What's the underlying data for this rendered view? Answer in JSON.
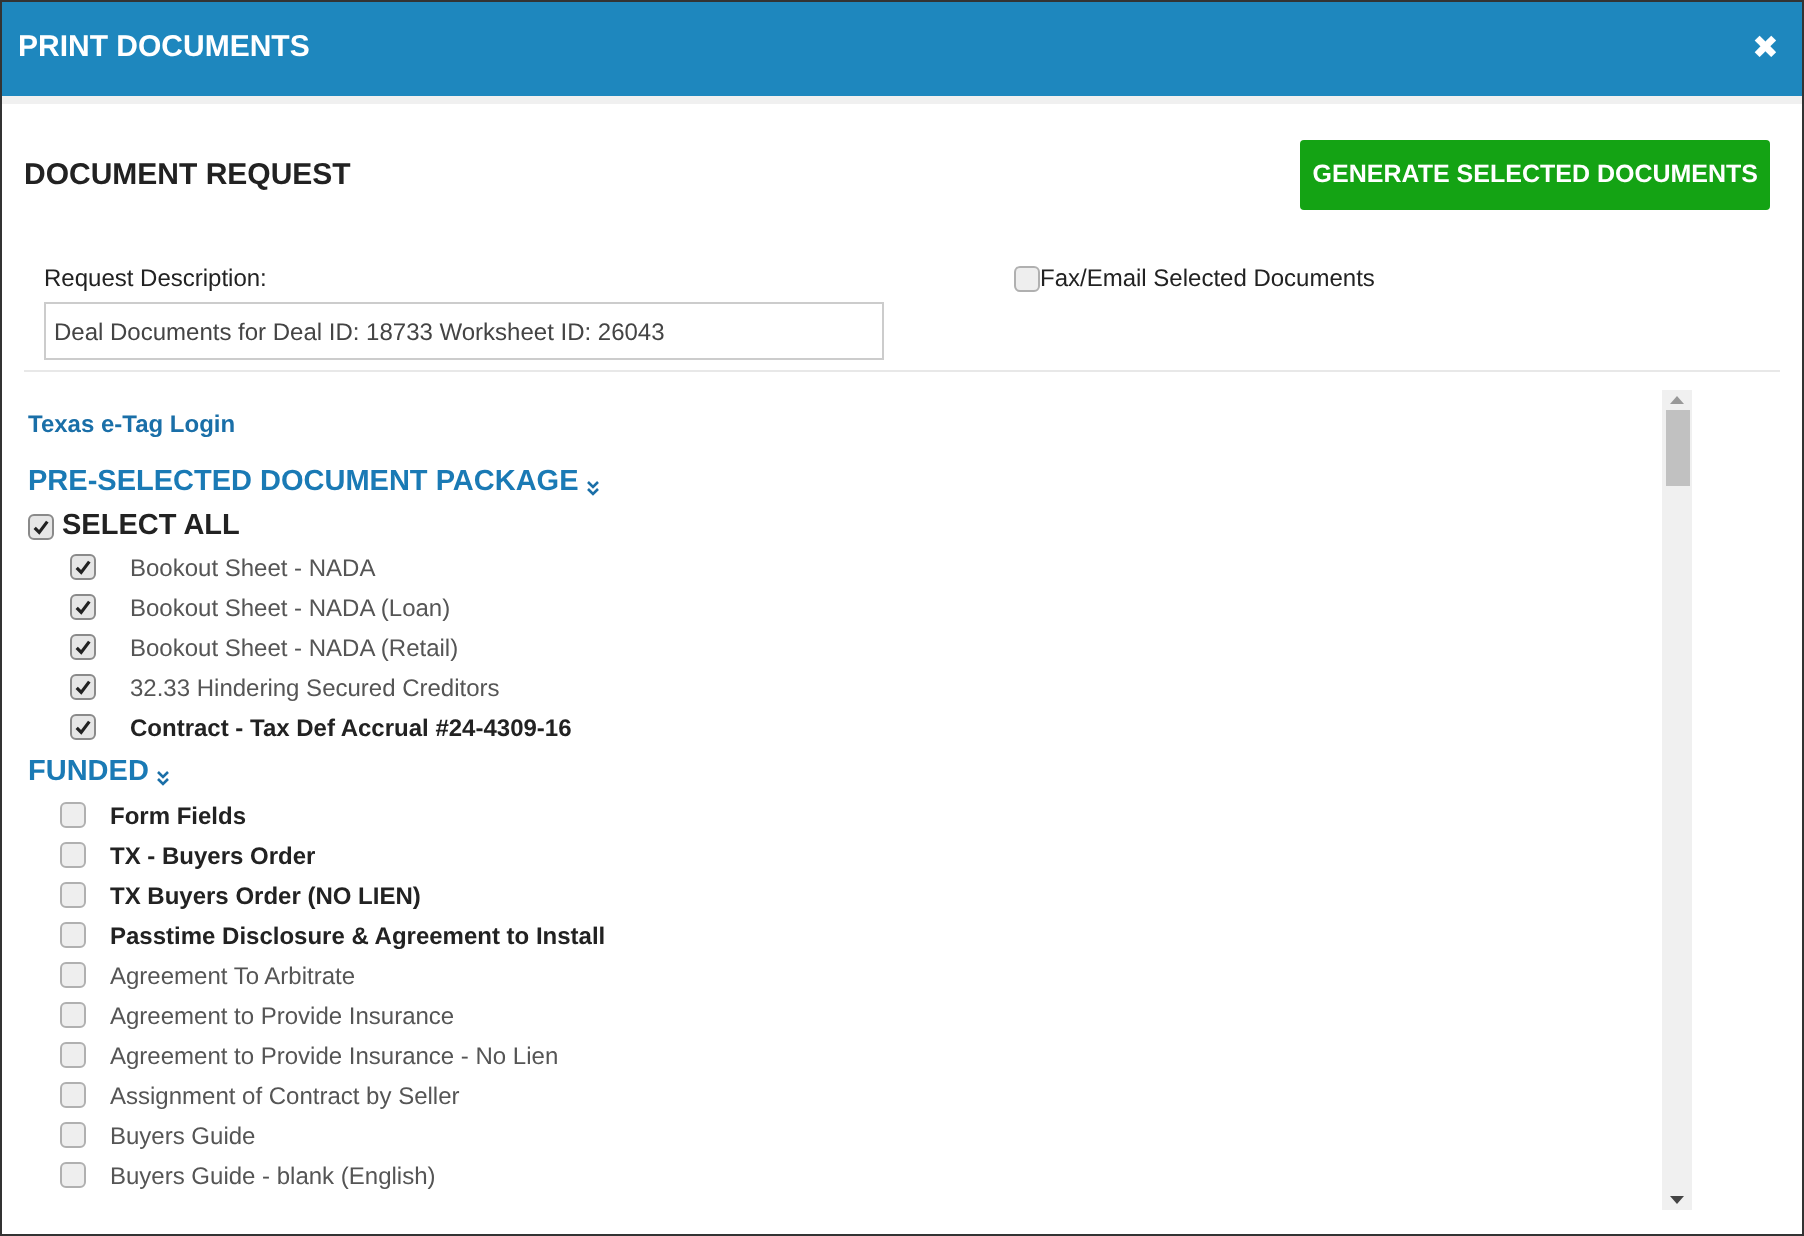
{
  "window": {
    "title": "PRINT DOCUMENTS",
    "close": "✖"
  },
  "request": {
    "title": "DOCUMENT REQUEST",
    "generate_button": "GENERATE SELECTED DOCUMENTS",
    "description_label": "Request Description:",
    "description_value": "Deal Documents for Deal ID: 18733 Worksheet ID: 26043",
    "fax_email": {
      "label": "Fax/Email Selected Documents",
      "checked": false
    }
  },
  "link": "Texas e-Tag Login",
  "packages": [
    {
      "title": "PRE-SELECTED DOCUMENT PACKAGE",
      "expanded": true,
      "select_all": {
        "label": "SELECT ALL",
        "checked": true
      },
      "items": [
        {
          "label": "Bookout Sheet - NADA",
          "checked": true,
          "bold": false
        },
        {
          "label": "Bookout Sheet - NADA (Loan)",
          "checked": true,
          "bold": false
        },
        {
          "label": "Bookout Sheet - NADA (Retail)",
          "checked": true,
          "bold": false
        },
        {
          "label": "32.33 Hindering Secured Creditors",
          "checked": true,
          "bold": false
        },
        {
          "label": "Contract - Tax Def Accrual #24-4309-16",
          "checked": true,
          "bold": true
        }
      ]
    },
    {
      "title": "FUNDED",
      "expanded": true,
      "items": [
        {
          "label": "Form Fields",
          "checked": false,
          "bold": true
        },
        {
          "label": "TX - Buyers Order",
          "checked": false,
          "bold": true
        },
        {
          "label": "TX Buyers Order (NO LIEN)",
          "checked": false,
          "bold": true
        },
        {
          "label": "Passtime Disclosure & Agreement to Install",
          "checked": false,
          "bold": true
        },
        {
          "label": "Agreement To Arbitrate",
          "checked": false,
          "bold": false
        },
        {
          "label": "Agreement to Provide Insurance",
          "checked": false,
          "bold": false
        },
        {
          "label": "Agreement to Provide Insurance - No Lien",
          "checked": false,
          "bold": false
        },
        {
          "label": "Assignment of Contract by Seller",
          "checked": false,
          "bold": false
        },
        {
          "label": "Buyers Guide",
          "checked": false,
          "bold": false
        },
        {
          "label": "Buyers Guide - blank (English)",
          "checked": false,
          "bold": false
        }
      ]
    }
  ]
}
